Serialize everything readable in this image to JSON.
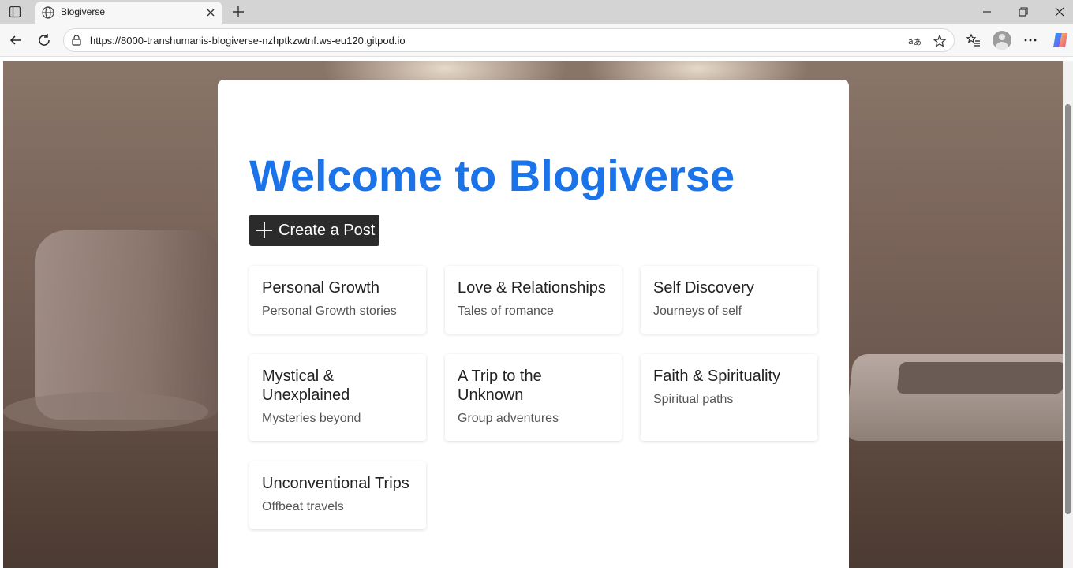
{
  "browser": {
    "tab_title": "Blogiverse",
    "url": "https://8000-transhumanis-blogiverse-nzhptkzwtnf.ws-eu120.gitpod.io"
  },
  "page": {
    "title": "Welcome to Blogiverse",
    "create_button": "Create a Post",
    "categories": [
      {
        "title": "Personal Growth",
        "description": "Personal Growth stories"
      },
      {
        "title": "Love & Relationships",
        "description": "Tales of romance"
      },
      {
        "title": "Self Discovery",
        "description": "Journeys of self"
      },
      {
        "title": "Mystical & Unexplained",
        "description": "Mysteries beyond"
      },
      {
        "title": "A Trip to the Unknown",
        "description": "Group adventures"
      },
      {
        "title": "Faith & Spirituality",
        "description": "Spiritual paths"
      },
      {
        "title": "Unconventional Trips",
        "description": "Offbeat travels"
      }
    ]
  },
  "colors": {
    "title_blue": "#1a73e8",
    "button_dark": "#2b2b2b"
  }
}
